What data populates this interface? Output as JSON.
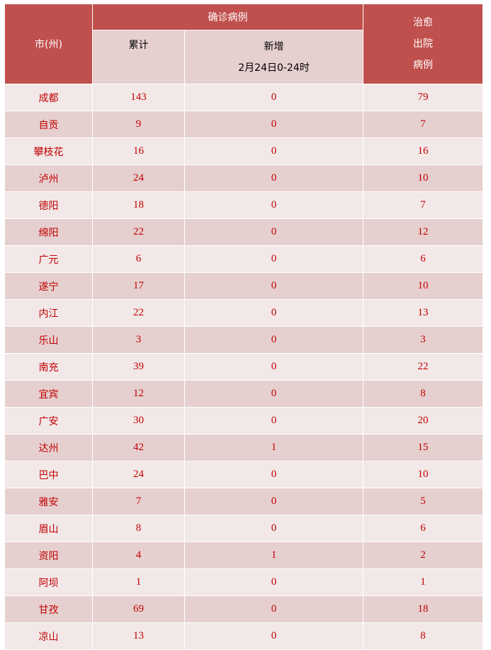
{
  "header": {
    "city": "市(州)",
    "confirmed": "确诊病例",
    "cumulative": "累计",
    "new": "新增",
    "new_date": "2月24日0-24时",
    "recovered": [
      "治愈",
      "出院",
      "病例"
    ]
  },
  "rows": [
    [
      "成都",
      "143",
      "0",
      "79"
    ],
    [
      "自贡",
      "9",
      "0",
      "7"
    ],
    [
      "攀枝花",
      "16",
      "0",
      "16"
    ],
    [
      "泸州",
      "24",
      "0",
      "10"
    ],
    [
      "德阳",
      "18",
      "0",
      "7"
    ],
    [
      "绵阳",
      "22",
      "0",
      "12"
    ],
    [
      "广元",
      "6",
      "0",
      "6"
    ],
    [
      "遂宁",
      "17",
      "0",
      "10"
    ],
    [
      "内江",
      "22",
      "0",
      "13"
    ],
    [
      "乐山",
      "3",
      "0",
      "3"
    ],
    [
      "南充",
      "39",
      "0",
      "22"
    ],
    [
      "宜宾",
      "12",
      "0",
      "8"
    ],
    [
      "广安",
      "30",
      "0",
      "20"
    ],
    [
      "达州",
      "42",
      "1",
      "15"
    ],
    [
      "巴中",
      "24",
      "0",
      "10"
    ],
    [
      "雅安",
      "7",
      "0",
      "5"
    ],
    [
      "眉山",
      "8",
      "0",
      "6"
    ],
    [
      "资阳",
      "4",
      "1",
      "2"
    ],
    [
      "阿坝",
      "1",
      "0",
      "1"
    ],
    [
      "甘孜",
      "69",
      "0",
      "18"
    ],
    [
      "凉山",
      "13",
      "0",
      "8"
    ]
  ],
  "colors": {
    "header": "#c0504d",
    "subheader": "#e6cfcf",
    "row_light": "#f2e8e8",
    "row_dark": "#e6cfcf",
    "text": "#c00000"
  }
}
